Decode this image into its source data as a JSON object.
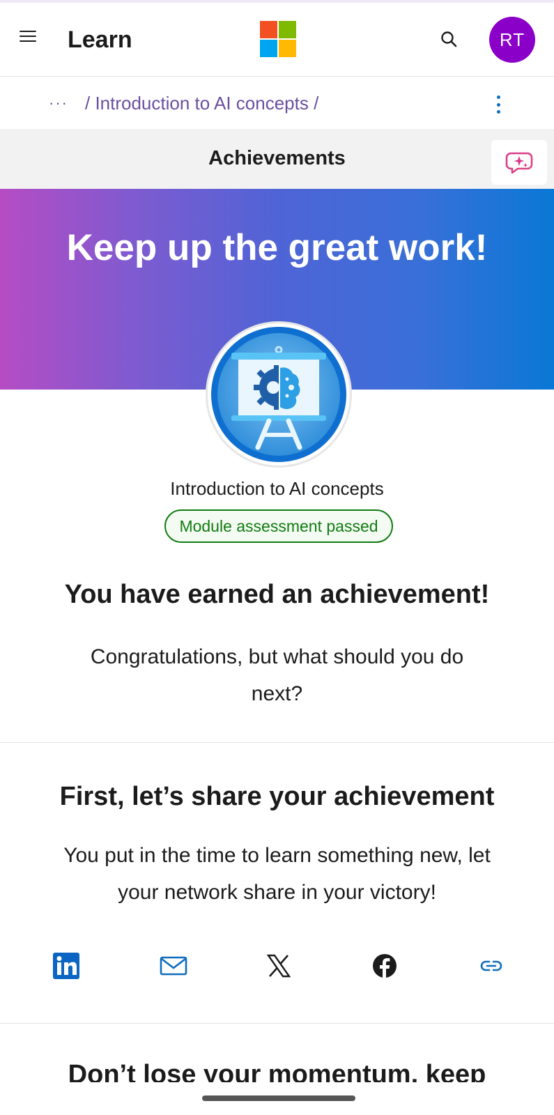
{
  "header": {
    "menu_icon": "hamburger-icon",
    "title": "Learn",
    "logo": "microsoft-logo",
    "search_icon": "search-icon",
    "avatar_initials": "RT"
  },
  "breadcrumb": {
    "more": "···",
    "path": "/ Introduction to AI concepts /",
    "menu_icon": "more-vertical-icon"
  },
  "achievements_bar": {
    "title": "Achievements",
    "copilot_icon": "copilot-sparkle-icon"
  },
  "hero": {
    "title": "Keep up the great work!",
    "badge_icon": "ai-presentation-badge-icon"
  },
  "module": {
    "name": "Introduction to AI concepts",
    "status": "Module assessment passed"
  },
  "earned": {
    "title": "You have earned an achievement!",
    "text": "Congratulations, but what should you do next?"
  },
  "share": {
    "title": "First, let’s share your achievement",
    "text": "You put in the time to learn something new, let your network share in your victory!",
    "icons": [
      "linkedin-icon",
      "email-icon",
      "x-icon",
      "facebook-icon",
      "link-icon"
    ]
  },
  "next_section": {
    "title": "Don’t lose your momentum, keep"
  },
  "colors": {
    "avatar": "#8b00c9",
    "breadcrumb_text": "#6a4fa0",
    "passed_green": "#107c10",
    "hero_gradient_start": "#b64cc4",
    "hero_gradient_end": "#0a78d6"
  }
}
